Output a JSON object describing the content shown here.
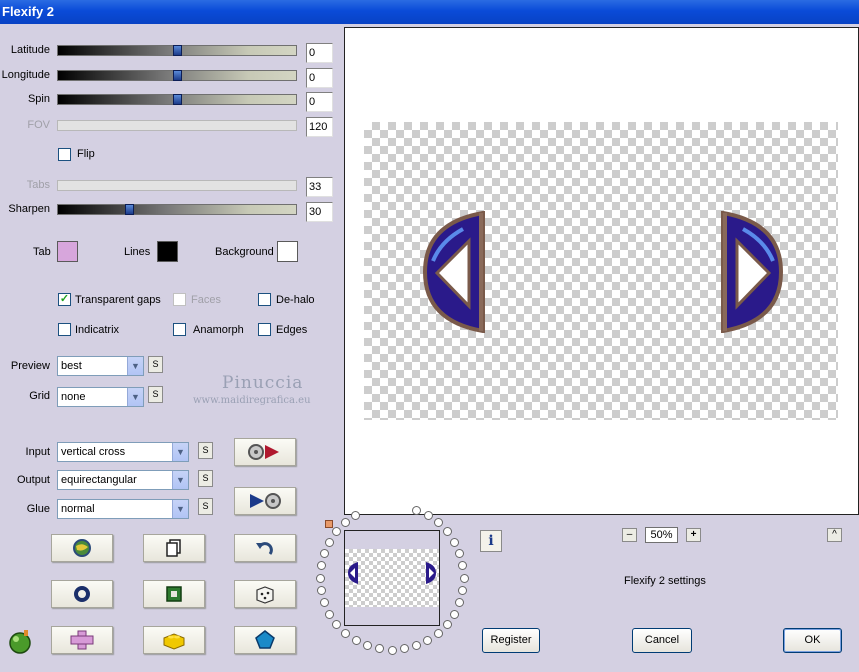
{
  "window": {
    "title": "Flexify 2"
  },
  "sliders": {
    "latitude": {
      "label": "Latitude",
      "value": "0",
      "fraction": 0.5,
      "enabled": true
    },
    "longitude": {
      "label": "Longitude",
      "value": "0",
      "fraction": 0.5,
      "enabled": true
    },
    "spin": {
      "label": "Spin",
      "value": "0",
      "fraction": 0.5,
      "enabled": true
    },
    "fov": {
      "label": "FOV",
      "value": "120",
      "enabled": false
    },
    "tabs": {
      "label": "Tabs",
      "value": "33",
      "enabled": false
    },
    "sharpen": {
      "label": "Sharpen",
      "value": "30",
      "fraction": 0.3,
      "enabled": true
    }
  },
  "flip": {
    "label": "Flip",
    "checked": false
  },
  "colors": {
    "tab": {
      "label": "Tab",
      "color": "#d7a6dc"
    },
    "lines": {
      "label": "Lines",
      "color": "#000000"
    },
    "background": {
      "label": "Background",
      "color": "#ffffff"
    }
  },
  "options": {
    "transparent_gaps": {
      "label": "Transparent gaps",
      "checked": true
    },
    "faces": {
      "label": "Faces",
      "checked": false,
      "enabled": false
    },
    "de_halo": {
      "label": "De-halo",
      "checked": false
    },
    "indicatrix": {
      "label": "Indicatrix",
      "checked": false
    },
    "anamorph": {
      "label": "Anamorph",
      "checked": false
    },
    "edges": {
      "label": "Edges",
      "checked": false
    }
  },
  "preview_mode": {
    "label": "Preview",
    "value": "best",
    "s": "S"
  },
  "grid": {
    "label": "Grid",
    "value": "none",
    "s": "S"
  },
  "watermark": {
    "name": "Pinuccia",
    "site": "www.maidiregrafica.eu"
  },
  "input": {
    "label": "Input",
    "value": "vertical cross",
    "s": "S"
  },
  "output": {
    "label": "Output",
    "value": "equirectangular",
    "s": "S"
  },
  "glue": {
    "label": "Glue",
    "value": "normal",
    "s": "S"
  },
  "icons": {
    "convert_forward": "disc-to-triangle-icon",
    "convert_back": "triangle-to-disc-icon",
    "randomize": "globe-icon",
    "copy": "pages-icon",
    "undo": "undo-arrow-icon",
    "ring": "ring-icon",
    "square": "square-icon",
    "dice": "dice-icon",
    "plugin": "green-planet-icon",
    "cross": "cross-icon",
    "brick": "yellow-brick-icon",
    "pentagon": "pentagon-icon",
    "info": "info-icon"
  },
  "zoom": {
    "minus": "–",
    "value": "50%",
    "plus": "+"
  },
  "settings_label": "Flexify 2 settings",
  "scroll_up": "^",
  "buttons": {
    "register": "Register",
    "cancel": "Cancel",
    "ok": "OK"
  }
}
